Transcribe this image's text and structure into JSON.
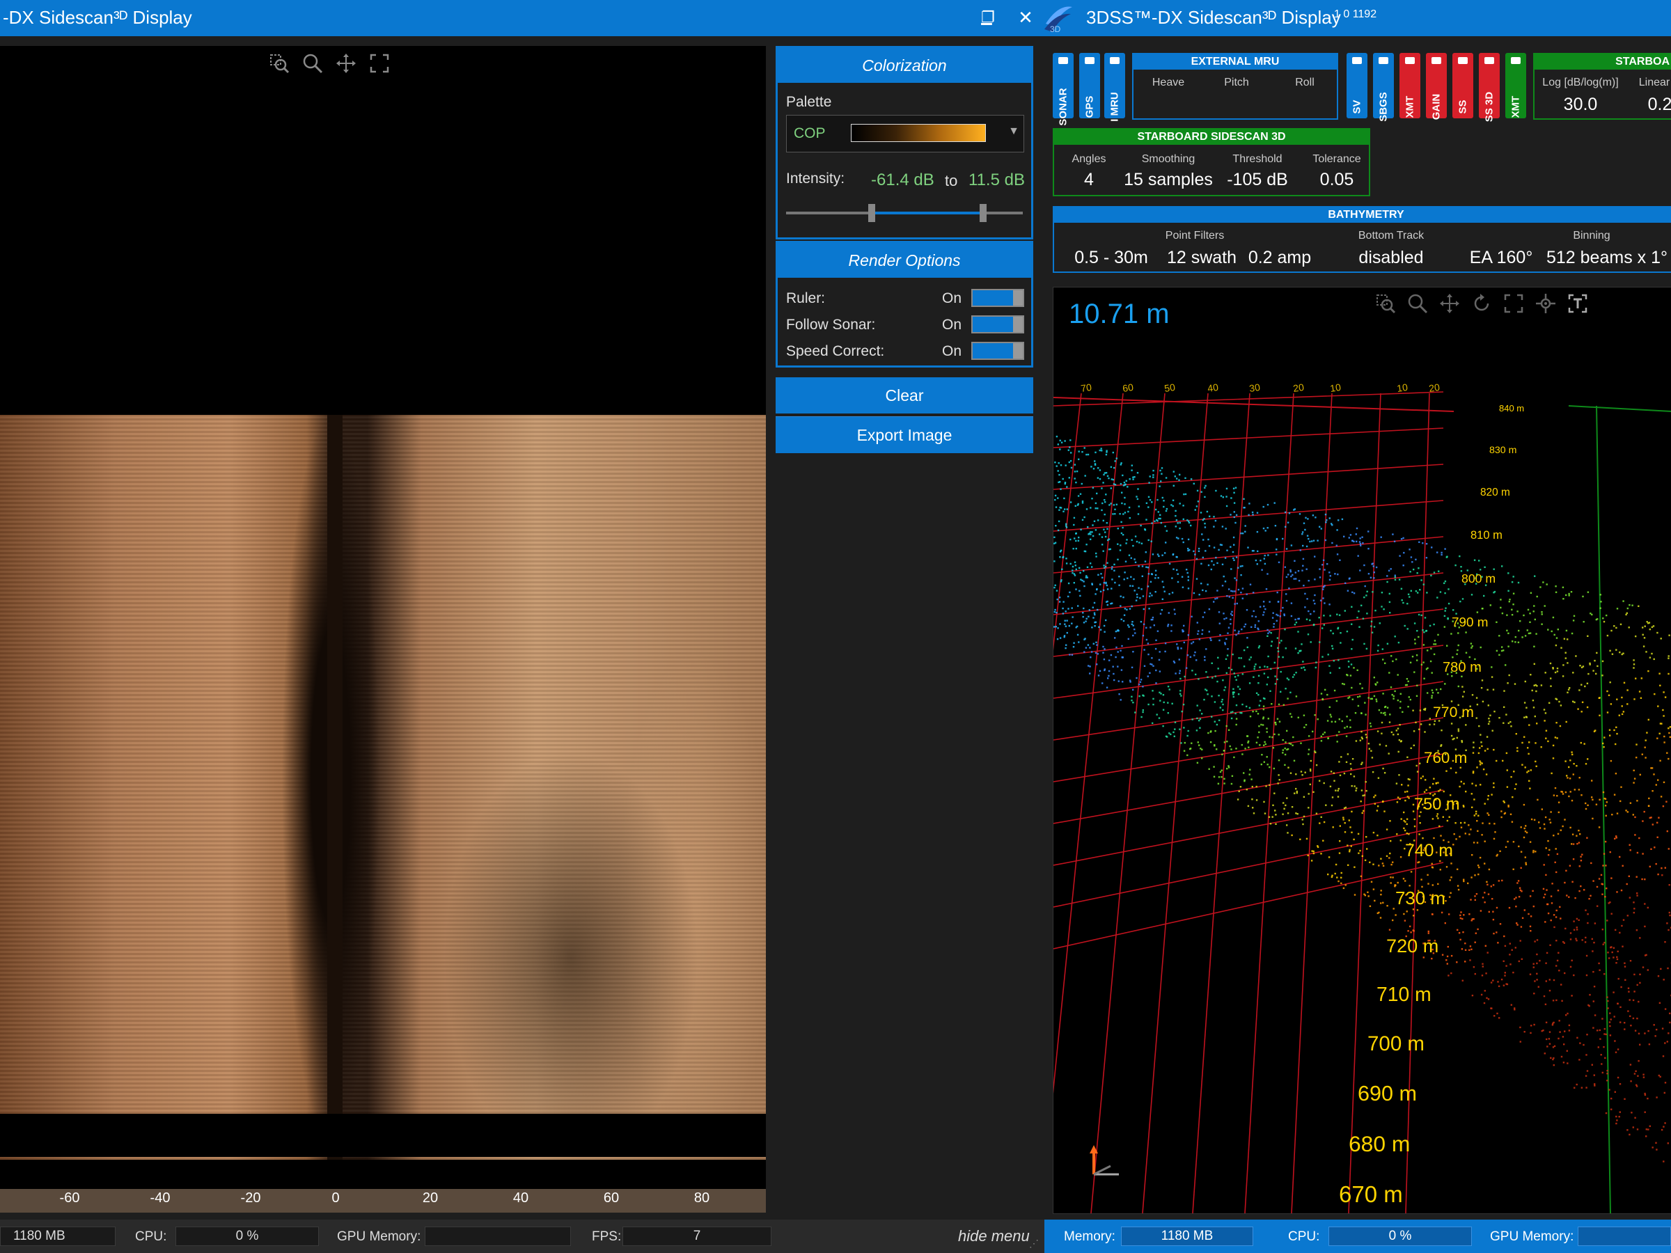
{
  "left_window": {
    "title": "-DX Sidescan³ᴰ Display"
  },
  "window_controls": {
    "minimize": "▁",
    "maximize": "▢",
    "close": "✕"
  },
  "right_window": {
    "title": "3DSS™-DX Sidescan³ᴰ Display",
    "version": "1 0 1192"
  },
  "sidescan": {
    "axis_ticks": [
      "-60",
      "-40",
      "-20",
      "0",
      "20",
      "40",
      "60",
      "80"
    ],
    "tools": [
      "zoom-box-icon",
      "zoom-icon",
      "pan-icon",
      "fit-icon"
    ]
  },
  "colorization": {
    "header": "Colorization",
    "palette_label": "Palette",
    "palette_value": "COP",
    "intensity_label": "Intensity:",
    "intensity_min": "-61.4 dB",
    "intensity_to": "to",
    "intensity_max": "11.5 dB"
  },
  "render_options": {
    "header": "Render Options",
    "rows": [
      {
        "label": "Ruler:",
        "state": "On"
      },
      {
        "label": "Follow Sonar:",
        "state": "On"
      },
      {
        "label": "Speed Correct:",
        "state": "On"
      }
    ]
  },
  "buttons": {
    "clear": "Clear",
    "export": "Export Image"
  },
  "statusbar": {
    "memory_left": "1180 MB",
    "cpu_label": "CPU:",
    "cpu_value_left": "0 %",
    "gpu_label": "GPU Memory:",
    "fps_label": "FPS:",
    "fps_value": "7",
    "hide_menu": "hide menu",
    "memory_label": "Memory:",
    "memory_right": "1180 MB",
    "cpu_value_right": "0 %"
  },
  "status_chips": [
    {
      "label": "SONAR",
      "color": "blue"
    },
    {
      "label": "GPS",
      "color": "blue"
    },
    {
      "label": "I MRU",
      "color": "blue"
    },
    {
      "label": "SV",
      "color": "blue"
    },
    {
      "label": "SBGS",
      "color": "blue"
    },
    {
      "label": "XMT",
      "color": "red"
    },
    {
      "label": "GAIN",
      "color": "red"
    },
    {
      "label": "SS",
      "color": "red"
    },
    {
      "label": "SS 3D",
      "color": "red"
    },
    {
      "label": "XMT",
      "color": "green"
    }
  ],
  "external_mru": {
    "header": "EXTERNAL MRU",
    "fields": [
      "Heave",
      "Pitch",
      "Roll"
    ]
  },
  "starboard": {
    "header": "STARBOA",
    "log_label": "Log [dB/log(m)]",
    "log_value": "30.0",
    "linear_label": "Linear",
    "linear_value": "0.2"
  },
  "starboard_3d": {
    "header": "STARBOARD SIDESCAN 3D",
    "cols": [
      {
        "label": "Angles",
        "value": "4"
      },
      {
        "label": "Smoothing",
        "value": "15 samples"
      },
      {
        "label": "Threshold",
        "value": "-105 dB"
      },
      {
        "label": "Tolerance",
        "value": "0.05"
      }
    ]
  },
  "bathymetry": {
    "header": "BATHYMETRY",
    "point_filters_label": "Point Filters",
    "point_filters": [
      "0.5 - 30m",
      "12 swath",
      "0.2 amp"
    ],
    "bottom_track_label": "Bottom Track",
    "bottom_track": "disabled",
    "binning_label": "Binning",
    "binning": [
      "EA 160°",
      "512 beams x 1°"
    ]
  },
  "view3d": {
    "readout": "10.71 m",
    "top_ticks": [
      "70",
      "60",
      "50",
      "40",
      "30",
      "20",
      "10",
      "10",
      "20"
    ],
    "depth_labels": [
      "840 m",
      "830 m",
      "820 m",
      "810 m",
      "800 m",
      "790 m",
      "780 m",
      "770 m",
      "760 m",
      "750 m",
      "740 m",
      "730 m",
      "720 m",
      "710 m",
      "700 m",
      "690 m",
      "680 m",
      "670 m"
    ],
    "tools": [
      "zoom-box-icon",
      "zoom-icon",
      "pan-icon",
      "rotate-icon",
      "fit-icon",
      "center-icon",
      "text-icon"
    ]
  }
}
